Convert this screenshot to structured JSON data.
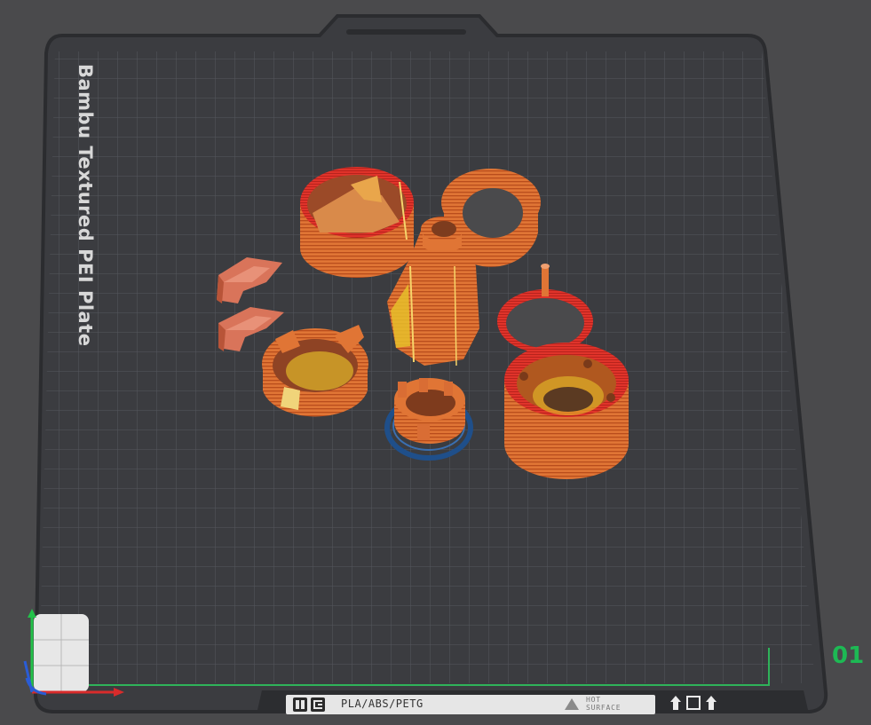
{
  "plate": {
    "name": "Bambu Textured PEI Plate",
    "number": "01",
    "material": "PLA/ABS/PETG",
    "hot_surface_line1": "HOT",
    "hot_surface_line2": "SURFACE"
  },
  "icons": {
    "brand_logo": "bambu-logo-icon",
    "brand_logo_2": "printer-logo-icon",
    "warning": "warning-triangle-icon",
    "lift_left": "up-arrow-icon",
    "plate_square": "square-icon",
    "lift_right": "up-arrow-icon"
  },
  "colors": {
    "background": "#4a4a4c",
    "plate": "#3c3d40",
    "grid": "#5a5b5f",
    "part_orange": "#e0773a",
    "part_red": "#e0352c",
    "part_yellow": "#e6c02a",
    "selected_blue": "#1f4f8a",
    "plate_number_green": "#1db954",
    "axis_x": "#d92b2b",
    "axis_y": "#23c24a",
    "axis_z": "#2a5cd6"
  }
}
